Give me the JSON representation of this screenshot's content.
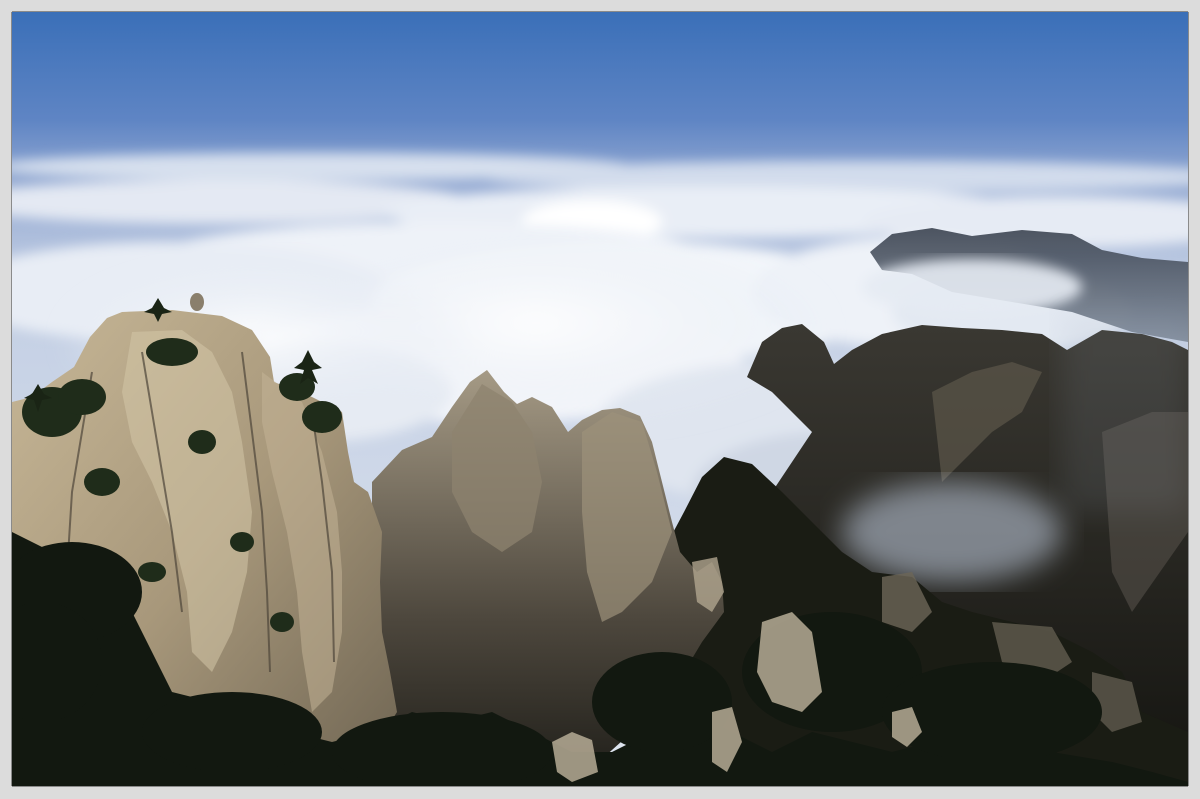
{
  "scene": {
    "subject": "mountain-peaks-above-sea-of-clouds",
    "colors": {
      "sky_top": "#3a6fb8",
      "sky_mid": "#7d9bcc",
      "sky_horizon": "#aebfdc",
      "cloud": "#e8edf5",
      "cloud_shadow": "#b9c6dc",
      "rock_light": "#b4a58a",
      "rock_dark": "#2b2a24",
      "vegetation": "#1d2a18",
      "frame": "#dcdcdc"
    }
  }
}
